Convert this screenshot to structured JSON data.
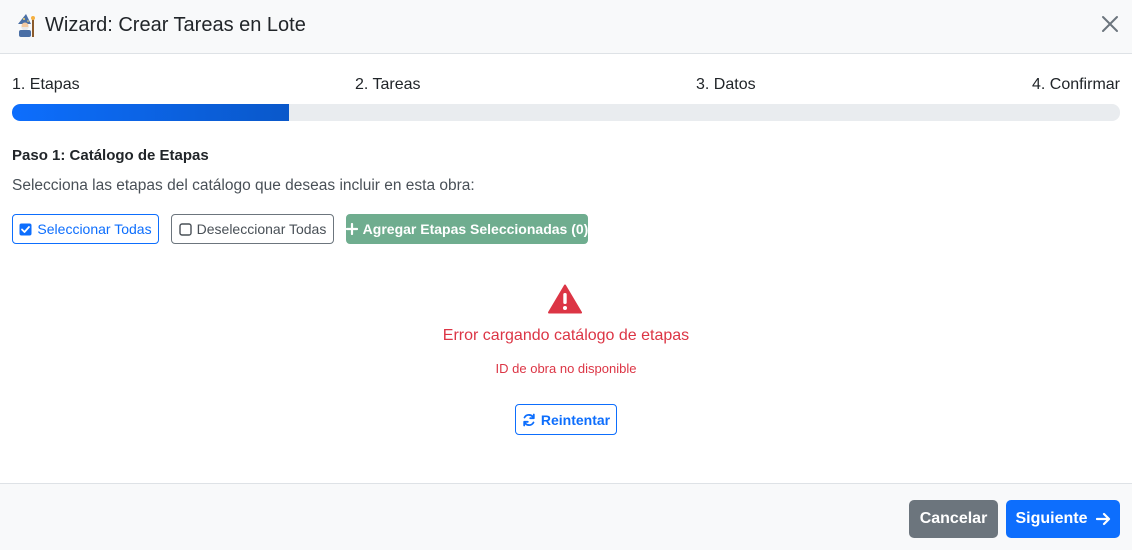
{
  "header": {
    "title": "Wizard: Crear Tareas en Lote",
    "icon": "wizard-icon",
    "close_icon": "close-icon"
  },
  "steps": {
    "labels": [
      "1. Etapas",
      "2. Tareas",
      "3. Datos",
      "4. Confirmar"
    ],
    "progress_fraction": 0.25,
    "progress_color": "#0d6efd"
  },
  "main": {
    "heading": "Paso 1: Catálogo de Etapas",
    "description": "Selecciona las etapas del catálogo que deseas incluir en esta obra:",
    "select_all_label": "Seleccionar Todas",
    "deselect_all_label": "Deseleccionar Todas",
    "add_selected_label": "Agregar Etapas Seleccionadas (0)",
    "error_title": "Error cargando catálogo de etapas",
    "error_detail": "ID de obra no disponible",
    "retry_label": "Reintentar"
  },
  "footer": {
    "cancel_label": "Cancelar",
    "next_label": "Siguiente"
  },
  "colors": {
    "primary": "#0d6efd",
    "danger": "#dc3545",
    "secondary": "#6c757d",
    "success_muted": "#6fad8f"
  }
}
